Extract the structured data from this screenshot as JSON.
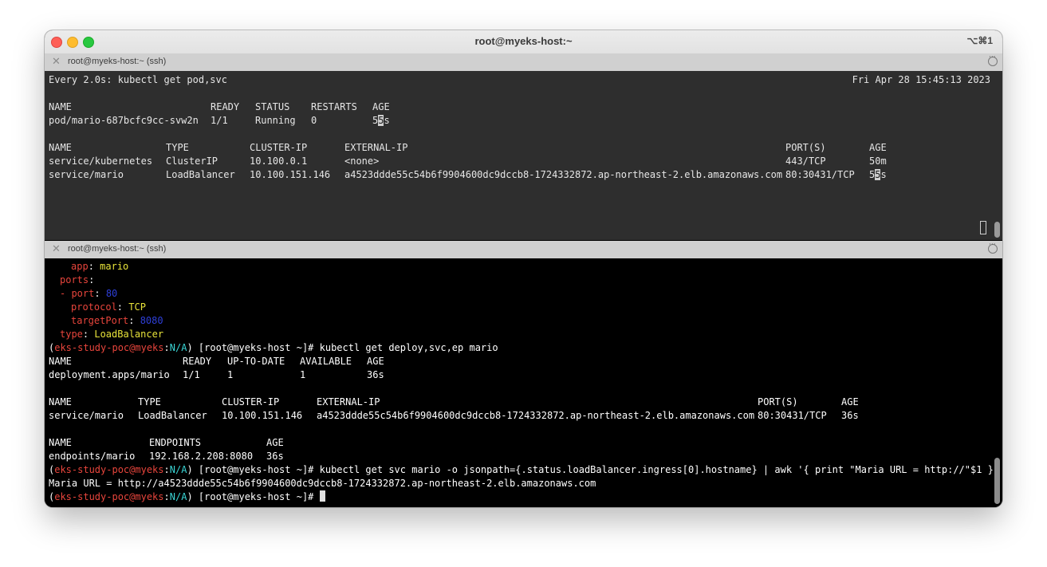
{
  "window": {
    "title": "root@myeks-host:~",
    "shortcut": "⌥⌘1"
  },
  "icons": [
    "close-window-icon",
    "minimize-window-icon",
    "maximize-window-icon",
    "close-pane-icon",
    "pane-menu-icon"
  ],
  "colors": {
    "window_close": "#fe5f57",
    "window_minimize": "#febc2e",
    "window_maximize": "#28c840",
    "top_pane_bg": "#2e2e2e",
    "bottom_pane_bg": "#000000",
    "prompt_red": "#e8453c",
    "prompt_cyan": "#3ad6d6",
    "yaml_yellow": "#e8e33a",
    "yaml_blue": "#2e3fd9"
  },
  "top_pane": {
    "header_label": "root@myeks-host:~ (ssh)",
    "watch_header": "Every 2.0s: kubectl get pod,svc",
    "timestamp": "Fri Apr 28 15:45:13 2023",
    "pods": {
      "headers": [
        "NAME",
        "READY",
        "STATUS",
        "RESTARTS",
        "AGE"
      ],
      "rows": [
        {
          "name": "pod/mario-687bcfc9cc-svw2n",
          "ready": "1/1",
          "status": "Running",
          "restarts": "0",
          "age_a": "5",
          "age_b": "5",
          "age_c": "s"
        }
      ]
    },
    "services": {
      "headers": [
        "NAME",
        "TYPE",
        "CLUSTER-IP",
        "EXTERNAL-IP",
        "PORT(S)",
        "AGE"
      ],
      "rows": [
        {
          "name": "service/kubernetes",
          "type": "ClusterIP",
          "cluster_ip": "10.100.0.1",
          "external_ip": "<none>",
          "ports": "443/TCP",
          "age": "50m"
        },
        {
          "name": "service/mario",
          "type": "LoadBalancer",
          "cluster_ip": "10.100.151.146",
          "external_ip": "a4523ddde55c54b6f9904600dc9dccb8-1724332872.ap-northeast-2.elb.amazonaws.com",
          "ports": "80:30431/TCP",
          "age_a": "5",
          "age_b": "5",
          "age_c": "s"
        }
      ]
    }
  },
  "bottom_pane": {
    "header_label": "root@myeks-host:~ (ssh)",
    "yaml": {
      "app_key": "app",
      "app_val": "mario",
      "ports_key": "ports",
      "port_dash": "- ",
      "port_key": "port",
      "port_val": "80",
      "protocol_key": "protocol",
      "protocol_val": "TCP",
      "target_key": "targetPort",
      "target_val": "8080",
      "type_key": "type",
      "type_val": "LoadBalancer"
    },
    "prompt": {
      "open": "(",
      "context": "eks-study-poc@myeks",
      "sep": ":",
      "ns": "N/A",
      "close": ")",
      "host": " [root@myeks-host ~]# "
    },
    "cmd1": "kubectl get deploy,svc,ep mario",
    "deploy": {
      "headers": [
        "NAME",
        "READY",
        "UP-TO-DATE",
        "AVAILABLE",
        "AGE"
      ],
      "row": {
        "name": "deployment.apps/mario",
        "ready": "1/1",
        "up_to_date": "1",
        "available": "1",
        "age": "36s"
      }
    },
    "svc": {
      "headers": [
        "NAME",
        "TYPE",
        "CLUSTER-IP",
        "EXTERNAL-IP",
        "PORT(S)",
        "AGE"
      ],
      "row": {
        "name": "service/mario",
        "type": "LoadBalancer",
        "cluster_ip": "10.100.151.146",
        "external_ip": "a4523ddde55c54b6f9904600dc9dccb8-1724332872.ap-northeast-2.elb.amazonaws.com",
        "ports": "80:30431/TCP",
        "age": "36s"
      }
    },
    "ep": {
      "headers": [
        "NAME",
        "ENDPOINTS",
        "AGE"
      ],
      "row": {
        "name": "endpoints/mario",
        "endpoints": "192.168.2.208:8080",
        "age": "36s"
      }
    },
    "cmd2": "kubectl get svc mario -o jsonpath={.status.loadBalancer.ingress[0].hostname} | awk '{ print \"Maria URL = http://\"$1 }'",
    "output_url": "Maria URL = http://a4523ddde55c54b6f9904600dc9dccb8-1724332872.ap-northeast-2.elb.amazonaws.com"
  }
}
